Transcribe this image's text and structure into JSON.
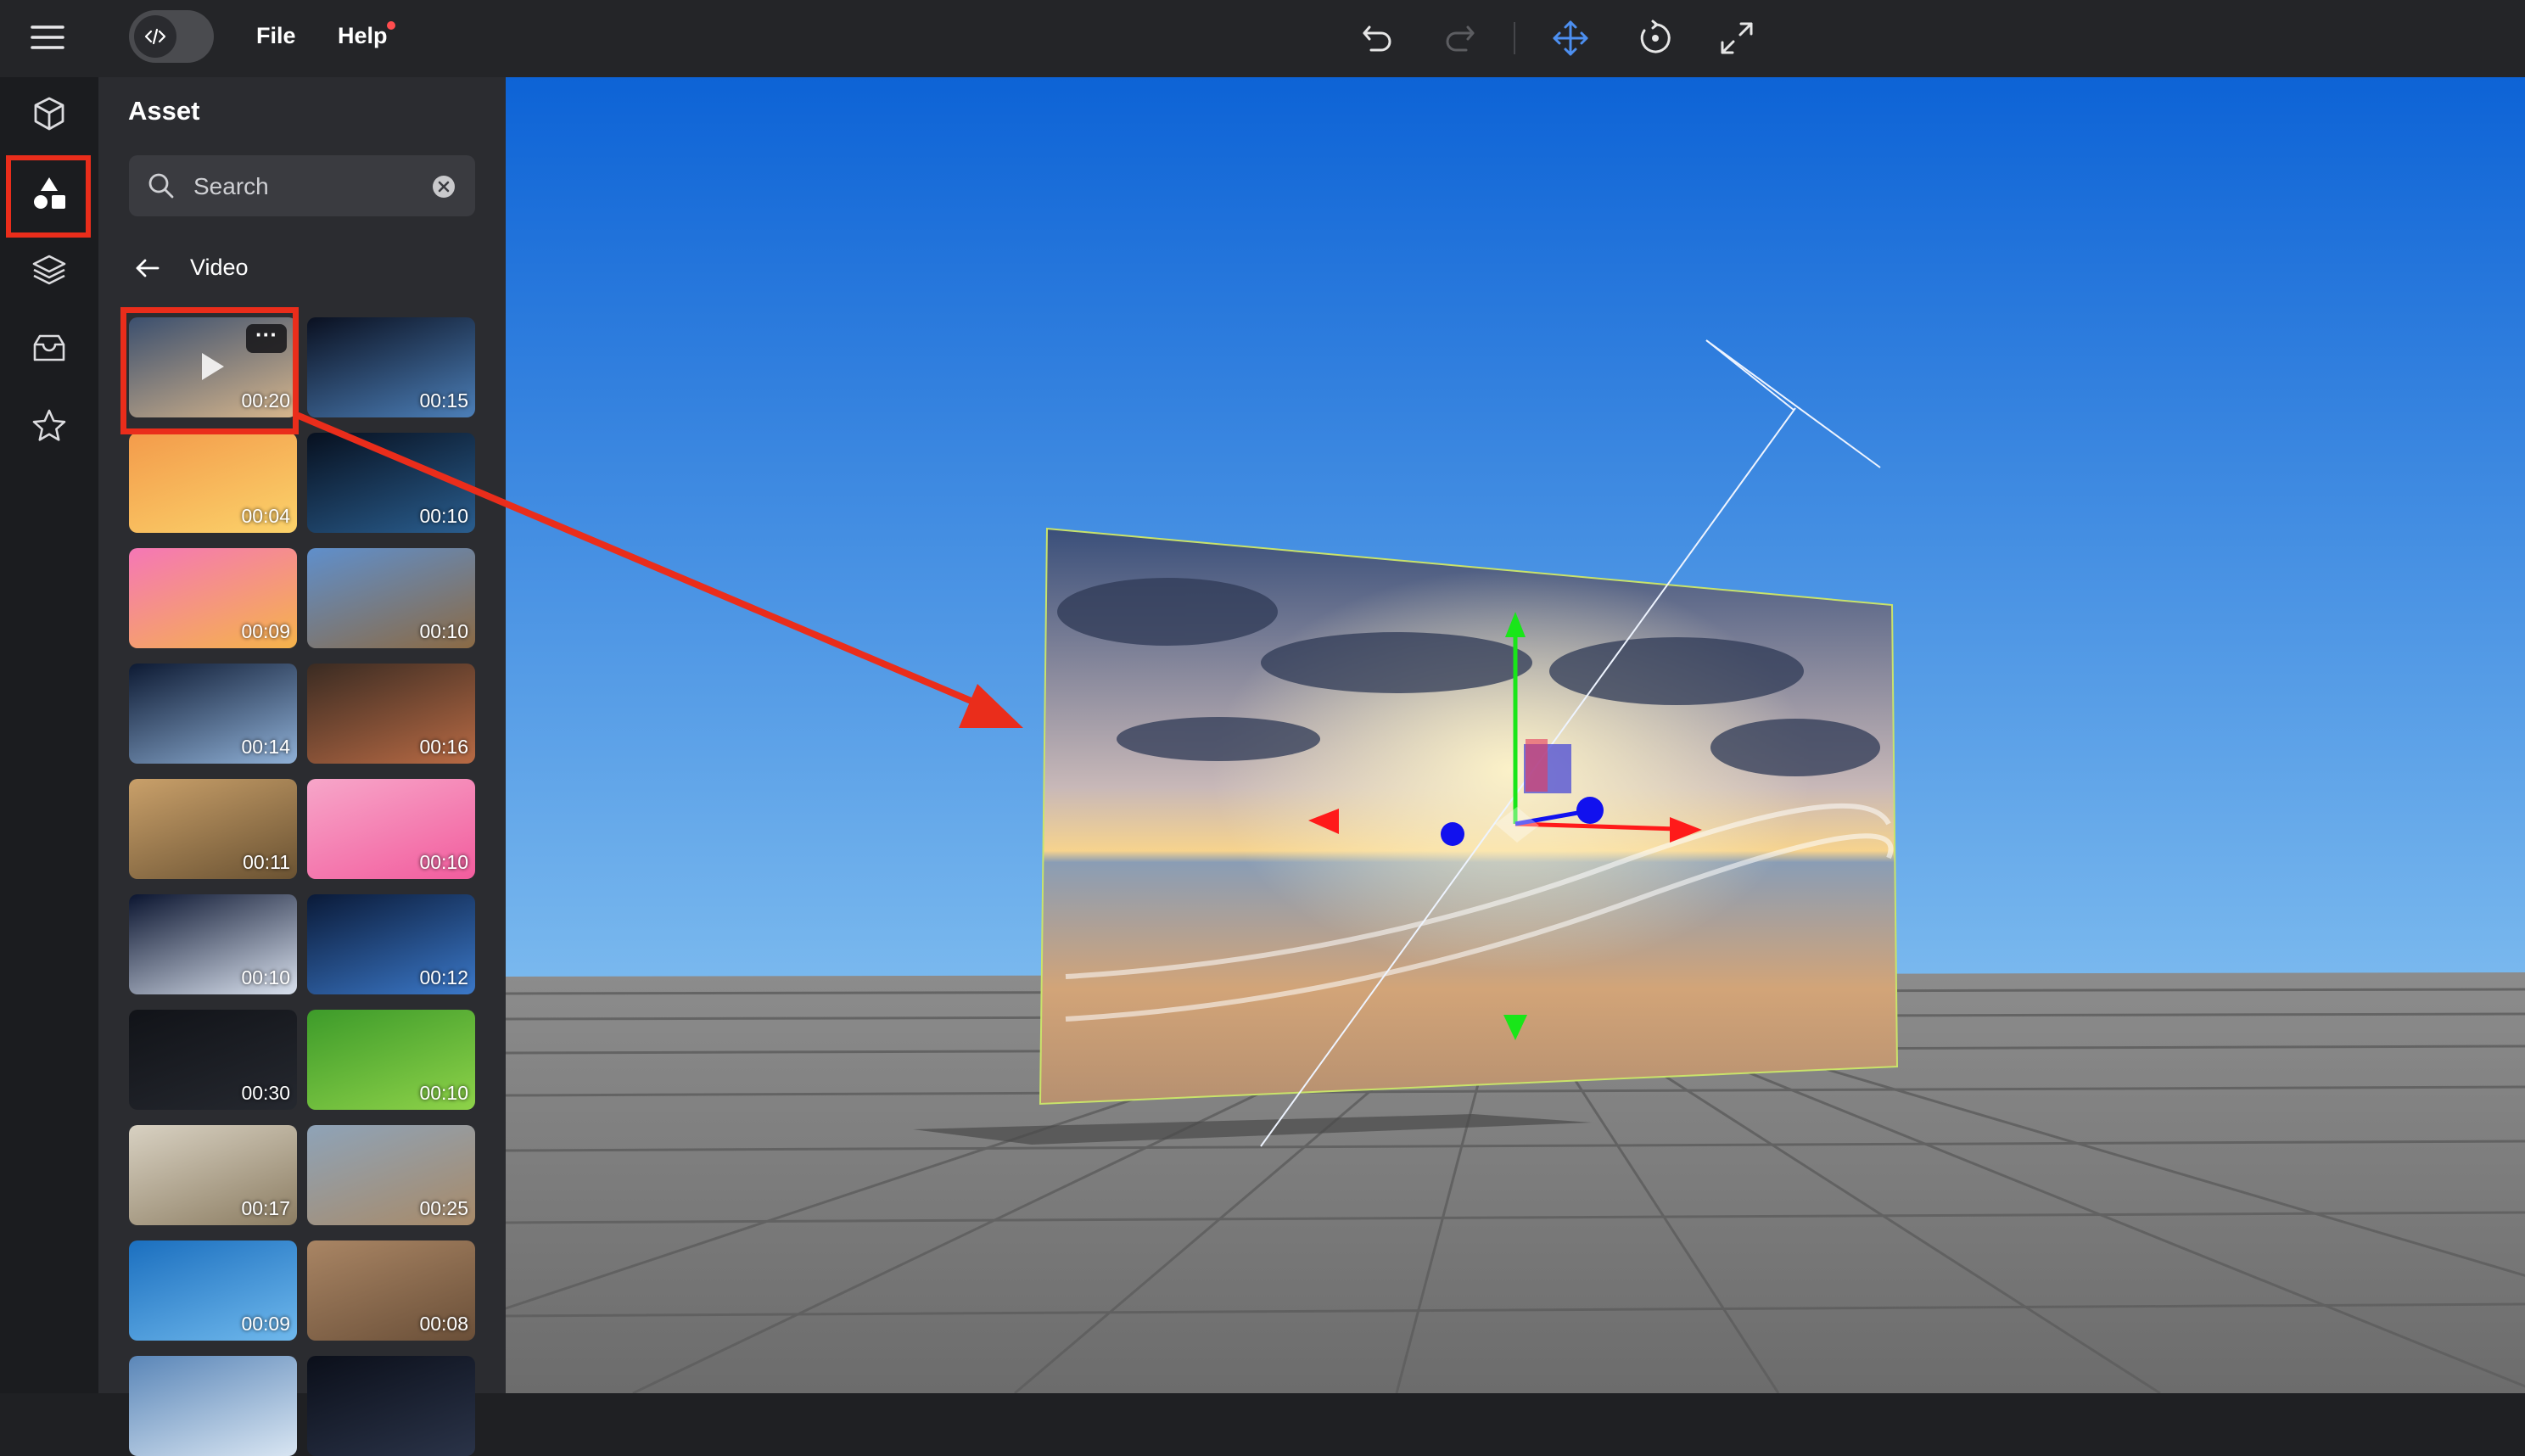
{
  "topbar": {
    "toggle_icon": "code-icon",
    "menu": [
      {
        "label": "File"
      },
      {
        "label": "Help",
        "has_notification_dot": true
      }
    ],
    "tools": [
      "undo-icon",
      "redo-icon",
      "move-icon",
      "rotate-icon",
      "fullscreen-icon"
    ]
  },
  "rail": {
    "items": [
      {
        "icon": "cube-icon",
        "active": false
      },
      {
        "icon": "shapes-icon",
        "active": true
      },
      {
        "icon": "layers-icon",
        "active": false
      },
      {
        "icon": "inbox-icon",
        "active": false
      },
      {
        "icon": "star-icon",
        "active": false
      }
    ]
  },
  "panel": {
    "title": "Asset",
    "search_placeholder": "Search",
    "category": "Video",
    "videos": [
      {
        "duration": "00:20",
        "colors": [
          "#3b4f6e",
          "#d7b68c"
        ]
      },
      {
        "duration": "00:15",
        "colors": [
          "#0a1020",
          "#4c7fb8"
        ]
      },
      {
        "duration": "00:04",
        "colors": [
          "#f39b4b",
          "#fbd26a"
        ]
      },
      {
        "duration": "00:10",
        "colors": [
          "#07101f",
          "#2a5e8f"
        ]
      },
      {
        "duration": "00:09",
        "colors": [
          "#f577b6",
          "#f5b34a"
        ]
      },
      {
        "duration": "00:10",
        "colors": [
          "#5f8fcc",
          "#8b6a44"
        ]
      },
      {
        "duration": "00:14",
        "colors": [
          "#0d1a33",
          "#8fb0d6"
        ]
      },
      {
        "duration": "00:16",
        "colors": [
          "#3a2b22",
          "#b86a44"
        ]
      },
      {
        "duration": "00:11",
        "colors": [
          "#c9a06a",
          "#6a5232"
        ]
      },
      {
        "duration": "00:10",
        "colors": [
          "#f7a6c9",
          "#f25c9d"
        ]
      },
      {
        "duration": "00:10",
        "colors": [
          "#0b1530",
          "#d9e1ee"
        ]
      },
      {
        "duration": "00:12",
        "colors": [
          "#0a1a38",
          "#3b78c8"
        ]
      },
      {
        "duration": "00:30",
        "colors": [
          "#111318",
          "#25282f"
        ]
      },
      {
        "duration": "00:10",
        "colors": [
          "#3d9b2a",
          "#8ed249"
        ]
      },
      {
        "duration": "00:17",
        "colors": [
          "#d8d1c2",
          "#8c7d62"
        ]
      },
      {
        "duration": "00:25",
        "colors": [
          "#8ea3b8",
          "#a88a68"
        ]
      },
      {
        "duration": "00:09",
        "colors": [
          "#1b6fbf",
          "#6fb8ec"
        ]
      },
      {
        "duration": "00:08",
        "colors": [
          "#a98564",
          "#6a4f38"
        ]
      },
      {
        "duration": "",
        "colors": [
          "#5a86b8",
          "#d8e5f2"
        ]
      },
      {
        "duration": "",
        "colors": [
          "#0b0f1a",
          "#2a3348"
        ]
      }
    ]
  },
  "colors": {
    "accent_highlight": "#ea2d1b",
    "sky_top": "#0f6fdc",
    "sky_bottom": "#6fb0ea",
    "floor": "#7a7a7a",
    "gizmo_x": "#ff1a1a",
    "gizmo_y": "#19e619",
    "gizmo_z": "#1111ee"
  }
}
